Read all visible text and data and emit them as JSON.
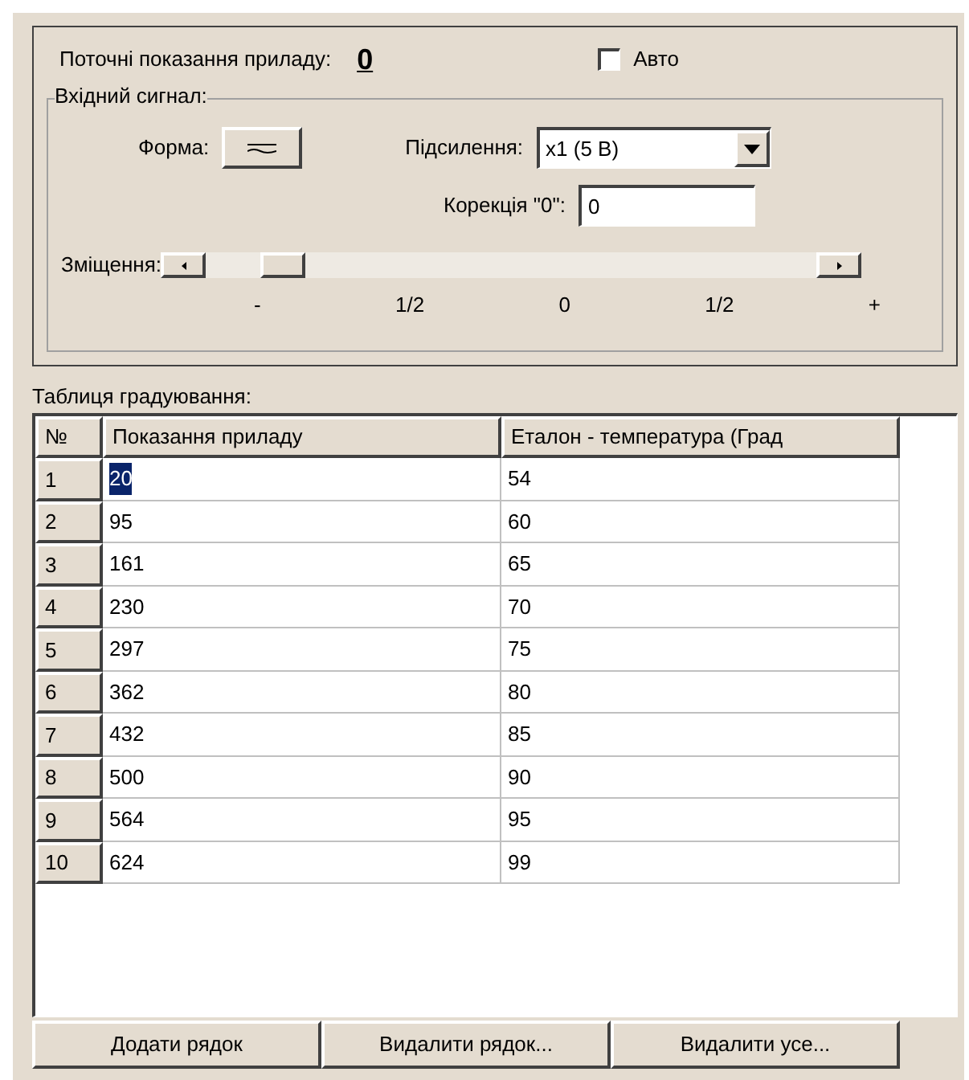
{
  "reading": {
    "label": "Поточні показання приладу:",
    "value": "0"
  },
  "auto": {
    "label": "Авто",
    "checked": false
  },
  "input_signal": {
    "title": "Вхідний сигнал:",
    "form_label": "Форма:",
    "gain_label": "Підсилення:",
    "gain_value": "x1 (5 В)",
    "correction_label": "Корекція \"0\":",
    "correction_value": "0",
    "offset_label": "Зміщення:",
    "scale": [
      "-",
      "1/2",
      "0",
      "1/2",
      "+"
    ]
  },
  "table": {
    "title": "Таблиця градуювання:",
    "columns": [
      "№",
      "Показання приладу",
      "Еталон - температура (Град"
    ],
    "rows": [
      {
        "cells": [
          "1",
          "20",
          "54"
        ],
        "selected": true
      },
      {
        "cells": [
          "2",
          "95",
          "60"
        ],
        "selected": false
      },
      {
        "cells": [
          "3",
          "161",
          "65"
        ],
        "selected": false
      },
      {
        "cells": [
          "4",
          "230",
          "70"
        ],
        "selected": false
      },
      {
        "cells": [
          "5",
          "297",
          "75"
        ],
        "selected": false
      },
      {
        "cells": [
          "6",
          "362",
          "80"
        ],
        "selected": false
      },
      {
        "cells": [
          "7",
          "432",
          "85"
        ],
        "selected": false
      },
      {
        "cells": [
          "8",
          "500",
          "90"
        ],
        "selected": false
      },
      {
        "cells": [
          "9",
          "564",
          "95"
        ],
        "selected": false
      },
      {
        "cells": [
          "10",
          "624",
          "99"
        ],
        "selected": false
      }
    ]
  },
  "buttons": [
    "Додати рядок",
    "Видалити рядок...",
    "Видалити усе..."
  ]
}
